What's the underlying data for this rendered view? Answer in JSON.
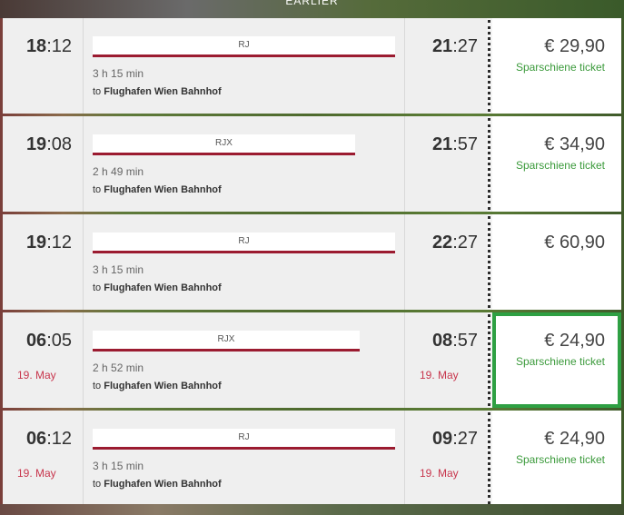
{
  "header": {
    "earlier_label": "EARLIER"
  },
  "connections": [
    {
      "dep_hour": "18",
      "dep_min": ":12",
      "dep_date": "",
      "train": "RJ",
      "duration": "3 h 15 min",
      "to_prefix": "to ",
      "destination": "Flughafen Wien Bahnhof",
      "arr_hour": "21",
      "arr_min": ":27",
      "arr_date": "",
      "price": "€ 29,90",
      "tariff": "Sparschiene ticket",
      "selected": false
    },
    {
      "dep_hour": "19",
      "dep_min": ":08",
      "dep_date": "",
      "train": "RJX",
      "duration": "2 h 49 min",
      "to_prefix": "to ",
      "destination": "Flughafen Wien Bahnhof",
      "arr_hour": "21",
      "arr_min": ":57",
      "arr_date": "",
      "price": "€ 34,90",
      "tariff": "Sparschiene ticket",
      "selected": false
    },
    {
      "dep_hour": "19",
      "dep_min": ":12",
      "dep_date": "",
      "train": "RJ",
      "duration": "3 h 15 min",
      "to_prefix": "to ",
      "destination": "Flughafen Wien Bahnhof",
      "arr_hour": "22",
      "arr_min": ":27",
      "arr_date": "",
      "price": "€ 60,90",
      "tariff": "",
      "selected": false
    },
    {
      "dep_hour": "06",
      "dep_min": ":05",
      "dep_date": "19. May",
      "train": "RJX",
      "duration": "2 h 52 min",
      "to_prefix": "to ",
      "destination": "Flughafen Wien Bahnhof",
      "arr_hour": "08",
      "arr_min": ":57",
      "arr_date": "19. May",
      "price": "€ 24,90",
      "tariff": "Sparschiene ticket",
      "selected": true
    },
    {
      "dep_hour": "06",
      "dep_min": ":12",
      "dep_date": "19. May",
      "train": "RJ",
      "duration": "3 h 15 min",
      "to_prefix": "to ",
      "destination": "Flughafen Wien Bahnhof",
      "arr_hour": "09",
      "arr_min": ":27",
      "arr_date": "19. May",
      "price": "€ 24,90",
      "tariff": "Sparschiene ticket",
      "selected": false
    }
  ],
  "colors": {
    "train_bar": "#9b1b30",
    "date_text": "#c8364d",
    "tariff_text": "#3b9a3b",
    "selected_border": "#2ea043"
  }
}
